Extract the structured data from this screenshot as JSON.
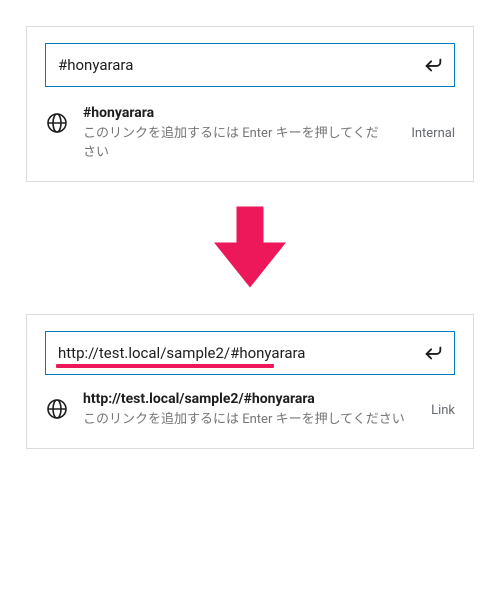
{
  "top": {
    "input_value": "#honyarara",
    "suggestion": {
      "title": "#honyarara",
      "desc": "このリンクを追加するには Enter キーを押してください",
      "tag": "Internal"
    }
  },
  "bottom": {
    "input_value": "http://test.local/sample2/#honyarara",
    "suggestion": {
      "title": "http://test.local/sample2/#honyarara",
      "desc": "このリンクを追加するには Enter キーを押してください",
      "tag": "Link"
    }
  },
  "icons": {
    "globe": "globe-icon",
    "submit": "arrow-return-icon"
  },
  "colors": {
    "accent": "#007cba",
    "highlight": "#ec185a"
  }
}
